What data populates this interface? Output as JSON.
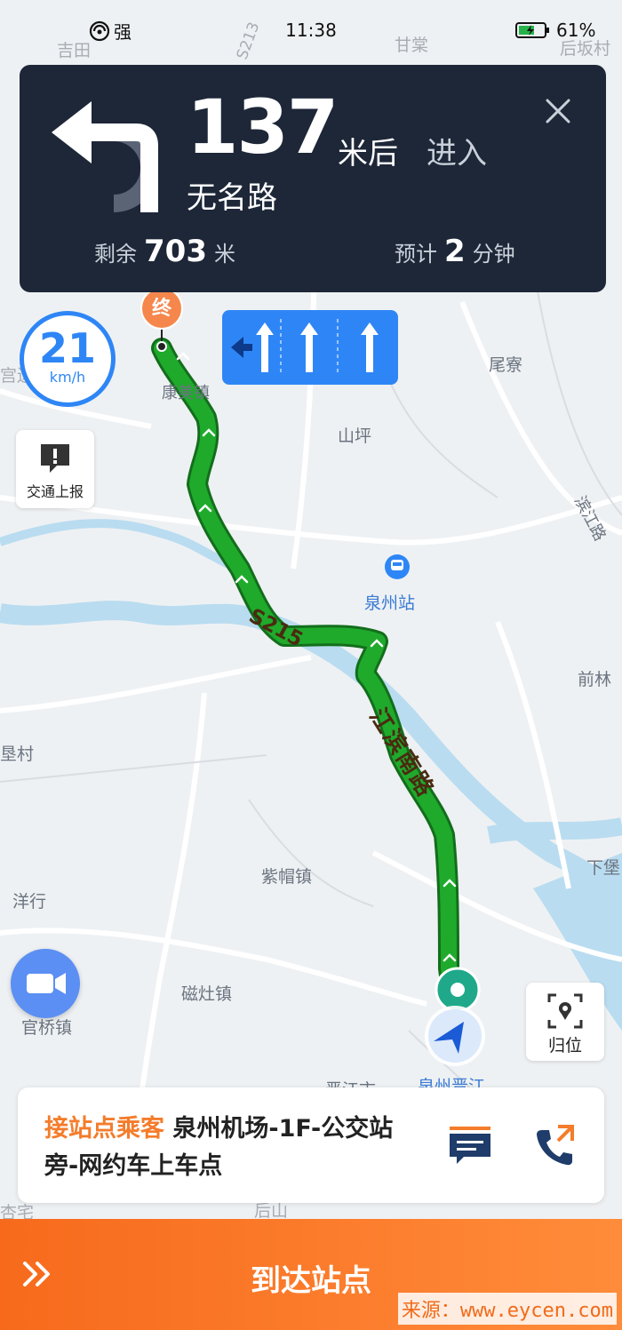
{
  "status_bar": {
    "signal_label": "强",
    "time": "11:38",
    "battery": "61%"
  },
  "navigation": {
    "distance": "137",
    "distance_unit": "米后",
    "action": "进入",
    "road_name": "无名路",
    "remaining_label": "剩余",
    "remaining_value": "703",
    "remaining_unit": "米",
    "eta_label": "预计",
    "eta_value": "2",
    "eta_unit": "分钟"
  },
  "speed": {
    "value": "21",
    "unit": "km/h"
  },
  "traffic_report": {
    "label": "交通上报"
  },
  "recenter": {
    "label": "归位"
  },
  "map": {
    "end_marker": "终",
    "route_labels": {
      "s215": "S215",
      "jiangbin": "江滨南路"
    },
    "labels": {
      "jitian": "吉田",
      "gantang": "甘棠",
      "houban": "后坂村",
      "s213": "S213",
      "kangmei": "康美镇",
      "gongbian": "宫边",
      "weiliao": "尾寮",
      "shanping": "山坪",
      "binjiang": "滨江路",
      "quanzhou_station": "泉州站",
      "qianlin": "前林",
      "shencun": "垦村",
      "zimao": "紫帽镇",
      "xiabao": "下堡",
      "yanghang": "洋行",
      "cizao": "磁灶镇",
      "guanqiao": "官桥镇",
      "jinjiang_city": "晋江市",
      "quanzhou_jinjiang": "泉州晋江",
      "xingzhai": "杏宅",
      "houshan": "后山"
    }
  },
  "pickup": {
    "tag": "接站点乘客",
    "location": "泉州机场-1F-公交站旁-网约车上车点"
  },
  "arrive": {
    "label": "到达站点"
  },
  "watermark": "来源：www.eycen.com",
  "colors": {
    "route_green": "#1faa2c",
    "nav_card_bg": "#1d2738",
    "accent_blue": "#2e86f6",
    "accent_orange": "#f47c2b"
  }
}
